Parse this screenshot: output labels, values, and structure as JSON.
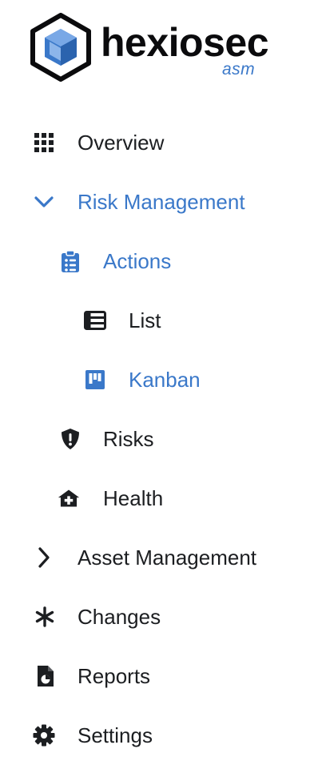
{
  "brand": {
    "name": "hexiosec",
    "sub": "asm",
    "accent_color": "#3a78c9",
    "logo_icon": "hexagon-cube-logo-icon"
  },
  "nav": {
    "overview": {
      "label": "Overview",
      "icon": "grid-icon"
    },
    "risk_management": {
      "label": "Risk Management",
      "icon": "chevron-down-icon",
      "expanded": true
    },
    "actions": {
      "label": "Actions",
      "icon": "clipboard-list-icon"
    },
    "list": {
      "label": "List",
      "icon": "table-list-icon"
    },
    "kanban": {
      "label": "Kanban",
      "icon": "kanban-board-icon",
      "selected": true
    },
    "risks": {
      "label": "Risks",
      "icon": "shield-exclamation-icon"
    },
    "health": {
      "label": "Health",
      "icon": "house-medical-icon"
    },
    "asset_management": {
      "label": "Asset Management",
      "icon": "chevron-right-icon",
      "expanded": false
    },
    "changes": {
      "label": "Changes",
      "icon": "asterisk-icon"
    },
    "reports": {
      "label": "Reports",
      "icon": "file-chart-icon"
    },
    "settings": {
      "label": "Settings",
      "icon": "gear-icon"
    }
  }
}
